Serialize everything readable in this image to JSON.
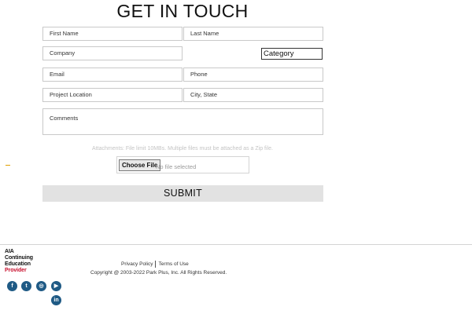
{
  "form": {
    "title": "GET IN TOUCH",
    "first_name_placeholder": "First Name",
    "last_name_placeholder": "Last Name",
    "company_placeholder": "Company",
    "category_value": "Category",
    "email_placeholder": "Email",
    "phone_placeholder": "Phone",
    "project_location_placeholder": "Project Location",
    "city_state_placeholder": "City, State",
    "comments_placeholder": "Comments",
    "attachments_note": "Attachments: File limit 10MBs. Multiple files must be attached as a Zip file.",
    "choose_file_label": "Choose File",
    "no_file_text": "No file selected",
    "submit_label": "SUBMIT"
  },
  "footer": {
    "aia_lines": [
      "AIA",
      "Continuing",
      "Education",
      "Provider"
    ],
    "privacy_label": "Privacy Policy",
    "terms_label": "Terms of Use",
    "copyright": "Copyright @ 2003-2022 Park Plus, Inc. All Rights Reserved.",
    "social": [
      {
        "name": "facebook-icon",
        "glyph": "f"
      },
      {
        "name": "twitter-icon",
        "glyph": "t"
      },
      {
        "name": "instagram-icon",
        "glyph": "◎"
      },
      {
        "name": "youtube-icon",
        "glyph": "▶"
      },
      {
        "name": "linkedin-icon",
        "glyph": "in"
      }
    ]
  },
  "colors": {
    "social_bg": "#1f5a85",
    "aia_red": "#c8102e",
    "submit_bg": "#e2e2e2"
  }
}
